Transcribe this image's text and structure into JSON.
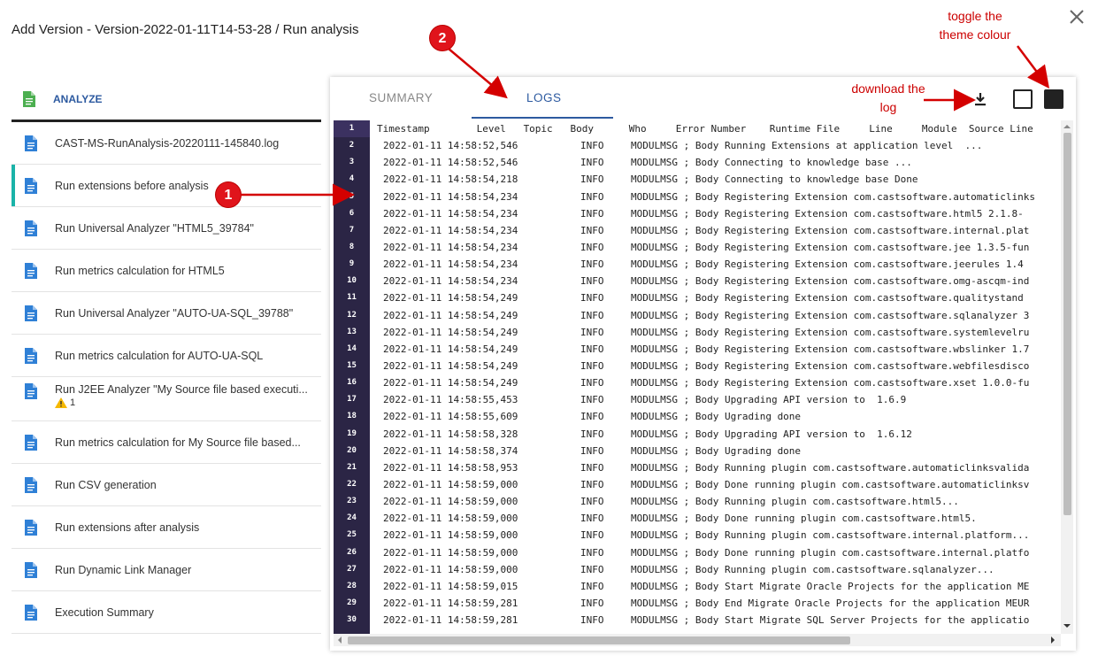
{
  "dialog": {
    "title": "Add Version - Version-2022-01-11T14-53-28 / Run analysis"
  },
  "sidebar": {
    "header": "ANALYZE",
    "items": [
      {
        "label": "CAST-MS-RunAnalysis-20220111-145840.log"
      },
      {
        "label": "Run extensions before analysis"
      },
      {
        "label": "Run Universal Analyzer \"HTML5_39784\""
      },
      {
        "label": "Run metrics calculation for HTML5"
      },
      {
        "label": "Run Universal Analyzer \"AUTO-UA-SQL_39788\""
      },
      {
        "label": "Run metrics calculation for AUTO-UA-SQL"
      },
      {
        "label": "Run J2EE Analyzer \"My Source file based executi...",
        "warning_count": "1"
      },
      {
        "label": "Run metrics calculation for My Source file based..."
      },
      {
        "label": "Run CSV generation"
      },
      {
        "label": "Run extensions after analysis"
      },
      {
        "label": "Run Dynamic Link Manager"
      },
      {
        "label": "Execution Summary"
      }
    ]
  },
  "tabs": {
    "summary": "SUMMARY",
    "logs": "LOGS"
  },
  "log": {
    "header": "Timestamp        Level   Topic   Body      Who     Error Number    Runtime File     Line     Module  Source Line",
    "rows": [
      {
        "ts": "2022-01-11 14:58:52,546",
        "level": "INFO",
        "body": "MODULMSG ; Body Running Extensions at application level  ..."
      },
      {
        "ts": "2022-01-11 14:58:52,546",
        "level": "INFO",
        "body": "MODULMSG ; Body Connecting to knowledge base ..."
      },
      {
        "ts": "2022-01-11 14:58:54,218",
        "level": "INFO",
        "body": "MODULMSG ; Body Connecting to knowledge base Done"
      },
      {
        "ts": "2022-01-11 14:58:54,234",
        "level": "INFO",
        "body": "MODULMSG ; Body Registering Extension com.castsoftware.automaticlinks"
      },
      {
        "ts": "2022-01-11 14:58:54,234",
        "level": "INFO",
        "body": "MODULMSG ; Body Registering Extension com.castsoftware.html5 2.1.8-"
      },
      {
        "ts": "2022-01-11 14:58:54,234",
        "level": "INFO",
        "body": "MODULMSG ; Body Registering Extension com.castsoftware.internal.plat"
      },
      {
        "ts": "2022-01-11 14:58:54,234",
        "level": "INFO",
        "body": "MODULMSG ; Body Registering Extension com.castsoftware.jee 1.3.5-fun"
      },
      {
        "ts": "2022-01-11 14:58:54,234",
        "level": "INFO",
        "body": "MODULMSG ; Body Registering Extension com.castsoftware.jeerules 1.4"
      },
      {
        "ts": "2022-01-11 14:58:54,234",
        "level": "INFO",
        "body": "MODULMSG ; Body Registering Extension com.castsoftware.omg-ascqm-ind"
      },
      {
        "ts": "2022-01-11 14:58:54,249",
        "level": "INFO",
        "body": "MODULMSG ; Body Registering Extension com.castsoftware.qualitystand"
      },
      {
        "ts": "2022-01-11 14:58:54,249",
        "level": "INFO",
        "body": "MODULMSG ; Body Registering Extension com.castsoftware.sqlanalyzer 3"
      },
      {
        "ts": "2022-01-11 14:58:54,249",
        "level": "INFO",
        "body": "MODULMSG ; Body Registering Extension com.castsoftware.systemlevelru"
      },
      {
        "ts": "2022-01-11 14:58:54,249",
        "level": "INFO",
        "body": "MODULMSG ; Body Registering Extension com.castsoftware.wbslinker 1.7"
      },
      {
        "ts": "2022-01-11 14:58:54,249",
        "level": "INFO",
        "body": "MODULMSG ; Body Registering Extension com.castsoftware.webfilesdisco"
      },
      {
        "ts": "2022-01-11 14:58:54,249",
        "level": "INFO",
        "body": "MODULMSG ; Body Registering Extension com.castsoftware.xset 1.0.0-fu"
      },
      {
        "ts": "2022-01-11 14:58:55,453",
        "level": "INFO",
        "body": "MODULMSG ; Body Upgrading API version to  1.6.9"
      },
      {
        "ts": "2022-01-11 14:58:55,609",
        "level": "INFO",
        "body": "MODULMSG ; Body Ugrading done"
      },
      {
        "ts": "2022-01-11 14:58:58,328",
        "level": "INFO",
        "body": "MODULMSG ; Body Upgrading API version to  1.6.12"
      },
      {
        "ts": "2022-01-11 14:58:58,374",
        "level": "INFO",
        "body": "MODULMSG ; Body Ugrading done"
      },
      {
        "ts": "2022-01-11 14:58:58,953",
        "level": "INFO",
        "body": "MODULMSG ; Body Running plugin com.castsoftware.automaticlinksvalida"
      },
      {
        "ts": "2022-01-11 14:58:59,000",
        "level": "INFO",
        "body": "MODULMSG ; Body Done running plugin com.castsoftware.automaticlinksv"
      },
      {
        "ts": "2022-01-11 14:58:59,000",
        "level": "INFO",
        "body": "MODULMSG ; Body Running plugin com.castsoftware.html5..."
      },
      {
        "ts": "2022-01-11 14:58:59,000",
        "level": "INFO",
        "body": "MODULMSG ; Body Done running plugin com.castsoftware.html5."
      },
      {
        "ts": "2022-01-11 14:58:59,000",
        "level": "INFO",
        "body": "MODULMSG ; Body Running plugin com.castsoftware.internal.platform..."
      },
      {
        "ts": "2022-01-11 14:58:59,000",
        "level": "INFO",
        "body": "MODULMSG ; Body Done running plugin com.castsoftware.internal.platfo"
      },
      {
        "ts": "2022-01-11 14:58:59,000",
        "level": "INFO",
        "body": "MODULMSG ; Body Running plugin com.castsoftware.sqlanalyzer..."
      },
      {
        "ts": "2022-01-11 14:58:59,015",
        "level": "INFO",
        "body": "MODULMSG ; Body Start Migrate Oracle Projects for the application ME"
      },
      {
        "ts": "2022-01-11 14:58:59,281",
        "level": "INFO",
        "body": "MODULMSG ; Body End Migrate Oracle Projects for the application MEUR"
      },
      {
        "ts": "2022-01-11 14:58:59,281",
        "level": "INFO",
        "body": "MODULMSG ; Body Start Migrate SQL Server Projects for the applicatio"
      }
    ]
  },
  "annotations": {
    "theme_note": "toggle the theme colour",
    "download_note": "download the log",
    "badge_1": "1",
    "badge_2": "2",
    "color": "#cc0000"
  }
}
